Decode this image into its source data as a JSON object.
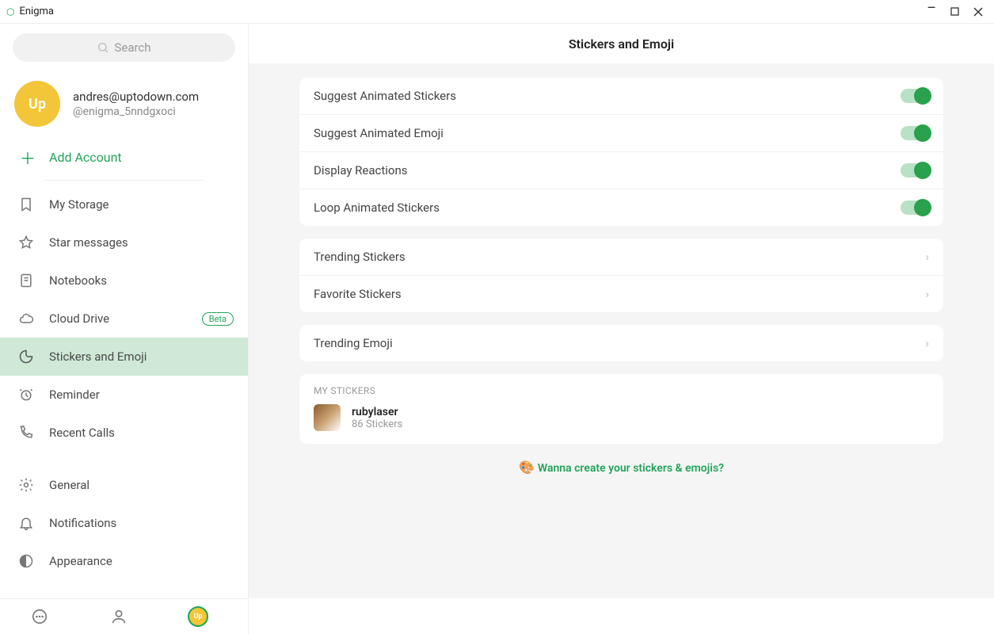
{
  "app": {
    "title": "Enigma"
  },
  "search": {
    "placeholder": "Search"
  },
  "profile": {
    "avatar_initials": "Up",
    "email": "andres@uptodown.com",
    "handle": "@enigma_5nndgxoci"
  },
  "add_account_label": "Add Account",
  "sidebar": {
    "items": [
      {
        "id": "my-storage",
        "label": "My Storage"
      },
      {
        "id": "star-messages",
        "label": "Star messages"
      },
      {
        "id": "notebooks",
        "label": "Notebooks"
      },
      {
        "id": "cloud-drive",
        "label": "Cloud Drive",
        "badge": "Beta"
      },
      {
        "id": "stickers-emoji",
        "label": "Stickers and Emoji",
        "active": true
      },
      {
        "id": "reminder",
        "label": "Reminder"
      },
      {
        "id": "recent-calls",
        "label": "Recent Calls"
      },
      {
        "id": "general",
        "label": "General"
      },
      {
        "id": "notifications",
        "label": "Notifications"
      },
      {
        "id": "appearance",
        "label": "Appearance"
      }
    ]
  },
  "main": {
    "title": "Stickers and Emoji",
    "toggles": [
      {
        "label": "Suggest Animated Stickers",
        "value": true
      },
      {
        "label": "Suggest Animated Emoji",
        "value": true
      },
      {
        "label": "Display Reactions",
        "value": true
      },
      {
        "label": "Loop Animated Stickers",
        "value": true
      }
    ],
    "links_a": [
      {
        "label": "Trending Stickers"
      },
      {
        "label": "Favorite Stickers"
      }
    ],
    "links_b": [
      {
        "label": "Trending Emoji"
      }
    ],
    "my_stickers": {
      "section_label": "MY STICKERS",
      "packs": [
        {
          "name": "rubylaser",
          "count_label": "86 Stickers"
        }
      ]
    },
    "create_prompt": "Wanna create your stickers & emojis?"
  },
  "bottombar": {
    "avatar_initials": "Up"
  }
}
